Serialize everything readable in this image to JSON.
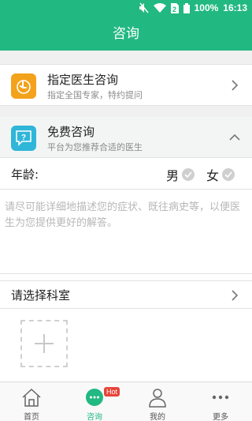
{
  "status_bar": {
    "battery": "100%",
    "time": "16:13"
  },
  "header": {
    "title": "咨询"
  },
  "doctor_consult": {
    "title": "指定医生咨询",
    "subtitle": "指定全国专家，特约提问"
  },
  "free_consult": {
    "title": "免费咨询",
    "subtitle": "平台为您推荐合适的医生"
  },
  "form": {
    "age_label": "年龄:",
    "gender_male": "男",
    "gender_female": "女",
    "description_placeholder": "请尽可能详细地描述您的症状、既往病史等，以便医生为您提供更好的解答。",
    "department_label": "请选择科室"
  },
  "tabbar": {
    "home": "首页",
    "consult": "咨询",
    "mine": "我的",
    "more": "更多",
    "hot_badge": "Hot"
  },
  "colors": {
    "accent": "#22b882",
    "orange": "#f3a21c",
    "blue": "#2fb6d9",
    "badge": "#e8443a"
  }
}
